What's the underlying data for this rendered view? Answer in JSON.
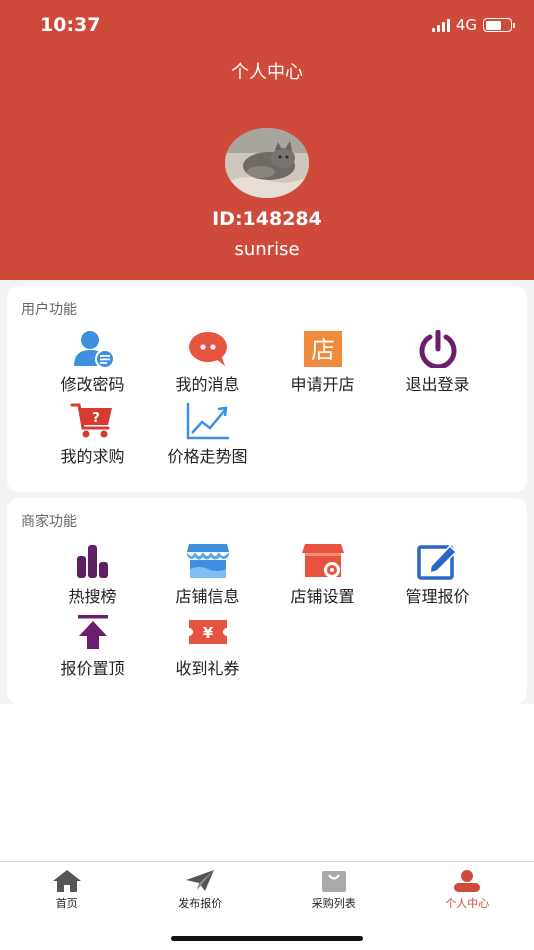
{
  "status_bar": {
    "time": "10:37",
    "network": "4G",
    "battery_level": 0.65
  },
  "header": {
    "title": "个人中心",
    "user_id": "ID:148284",
    "username": "sunrise"
  },
  "user_functions": {
    "title": "用户功能",
    "items": [
      {
        "label": "修改密码",
        "icon": "user-edit-icon",
        "color": "#3d8fe0"
      },
      {
        "label": "我的消息",
        "icon": "message-bubble-icon",
        "color": "#e8533f"
      },
      {
        "label": "申请开店",
        "icon": "shop-apply-icon",
        "color": "#f08a3c",
        "glyph": "店"
      },
      {
        "label": "退出登录",
        "icon": "power-icon",
        "color": "#6b1e6e"
      },
      {
        "label": "我的求购",
        "icon": "cart-question-icon",
        "color": "#d63a31",
        "glyph": "?"
      },
      {
        "label": "价格走势图",
        "icon": "trend-chart-icon",
        "color": "#3d8fe0"
      }
    ]
  },
  "merchant_functions": {
    "title": "商家功能",
    "items": [
      {
        "label": "热搜榜",
        "icon": "bar-rank-icon",
        "color": "#5e1f63"
      },
      {
        "label": "店铺信息",
        "icon": "storefront-icon",
        "color": "#3d8fe0"
      },
      {
        "label": "店铺设置",
        "icon": "store-settings-icon",
        "color": "#e8533f"
      },
      {
        "label": "管理报价",
        "icon": "edit-box-icon",
        "color": "#2a66c9"
      },
      {
        "label": "报价置顶",
        "icon": "pin-top-icon",
        "color": "#6b1e6e"
      },
      {
        "label": "收到礼券",
        "icon": "coupon-icon",
        "color": "#e8533f",
        "glyph": "¥"
      }
    ]
  },
  "tabbar": {
    "tabs": [
      {
        "label": "首页",
        "icon": "home-icon",
        "active": false
      },
      {
        "label": "发布报价",
        "icon": "paper-plane-icon",
        "active": false
      },
      {
        "label": "采购列表",
        "icon": "shopping-bag-icon",
        "active": false
      },
      {
        "label": "个人中心",
        "icon": "person-icon",
        "active": true
      }
    ]
  },
  "colors": {
    "brand": "#cf4a3b",
    "background": "#f3f3f3"
  }
}
